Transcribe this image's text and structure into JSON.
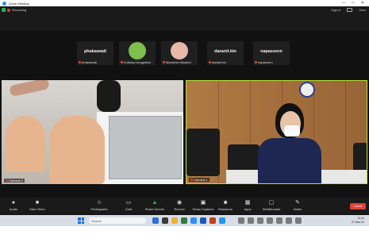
{
  "window": {
    "title": "Zoom Meeting",
    "controls": [
      "—",
      "□",
      "✕"
    ]
  },
  "topbar": {
    "recording_label": "Recording",
    "sign_in": "Sign in",
    "view_label": "View"
  },
  "participants_strip": [
    {
      "name": "phakawadi",
      "caption": "phakawadi",
      "has_photo": false
    },
    {
      "name": "",
      "caption": "Kotsing Kongpakai...",
      "has_photo": true,
      "photo_color": "#7fbf4d"
    },
    {
      "name": "",
      "caption": "Manitcha Wiyakot",
      "has_photo": true,
      "photo_color": "#e8b8a8"
    },
    {
      "name": "daranit.kin",
      "caption": "daranit.kin",
      "has_photo": false
    },
    {
      "name": "napassorn",
      "caption": "napassorn",
      "has_photo": false
    }
  ],
  "videos": [
    {
      "label": "Camera 2"
    },
    {
      "label": "Camera 1"
    }
  ],
  "toolbar": {
    "items": [
      {
        "label": "Audio",
        "icon": "microphone-icon"
      },
      {
        "label": "Start Video",
        "icon": "video-camera-icon"
      },
      {
        "label": "Participants",
        "icon": "participants-icon",
        "count": "43"
      },
      {
        "label": "Chat",
        "icon": "chat-icon"
      },
      {
        "label": "Share Screen",
        "icon": "share-screen-icon"
      },
      {
        "label": "Record",
        "icon": "record-icon"
      },
      {
        "label": "Show Captions",
        "icon": "captions-icon"
      },
      {
        "label": "Reactions",
        "icon": "reactions-icon"
      },
      {
        "label": "Apps",
        "icon": "apps-icon"
      },
      {
        "label": "Whiteboards",
        "icon": "whiteboard-icon"
      },
      {
        "label": "Notes",
        "icon": "notes-icon"
      }
    ],
    "leave_label": "Leave",
    "share_color": "#23c552"
  },
  "taskbar": {
    "search_placeholder": "Search",
    "time": "13:41",
    "date": "27-Mar-24"
  }
}
